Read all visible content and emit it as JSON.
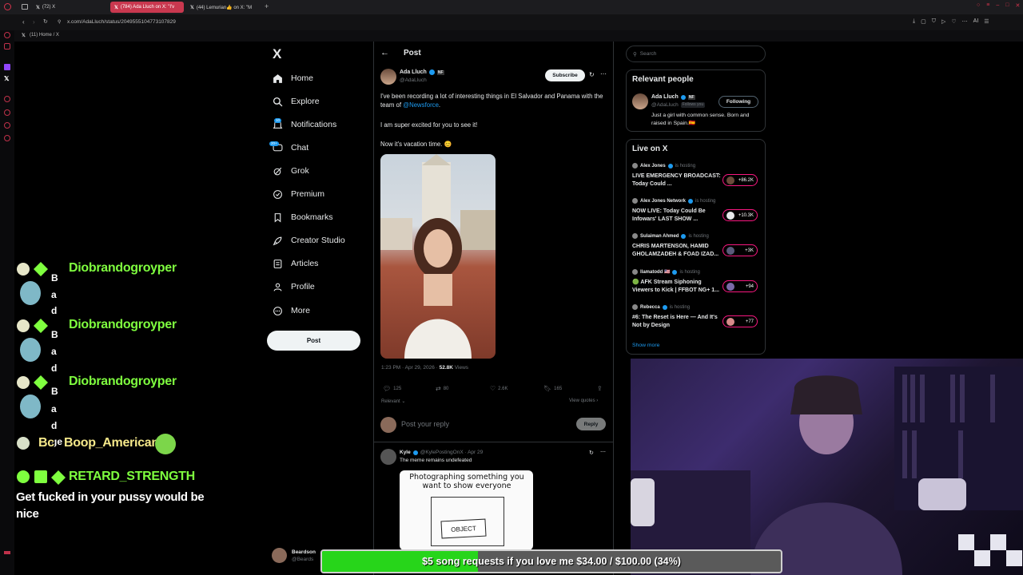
{
  "browser": {
    "tabs": [
      {
        "label": "(72) X"
      },
      {
        "label": "(784) Ada Lluch on X: \"I'v"
      },
      {
        "label": "(44) Lemurian👍 on X: \"M"
      }
    ],
    "url": "x.com/AdaLluch/status/2049555104773107829",
    "bookmark": "(11) Home / X",
    "ai_label": "AI"
  },
  "nav": {
    "logo": "X",
    "items": [
      {
        "label": "Home",
        "icon": "home-icon"
      },
      {
        "label": "Explore",
        "icon": "search-icon"
      },
      {
        "label": "Notifications",
        "icon": "bell-icon",
        "badge": "10"
      },
      {
        "label": "Chat",
        "icon": "chat-icon",
        "badge": "20+"
      },
      {
        "label": "Grok",
        "icon": "grok-icon"
      },
      {
        "label": "Premium",
        "icon": "premium-icon"
      },
      {
        "label": "Bookmarks",
        "icon": "bookmark-icon"
      },
      {
        "label": "Creator Studio",
        "icon": "rocket-icon"
      },
      {
        "label": "Articles",
        "icon": "articles-icon"
      },
      {
        "label": "Profile",
        "icon": "person-icon"
      },
      {
        "label": "More",
        "icon": "more-icon"
      }
    ],
    "post_button": "Post",
    "account": {
      "name": "Beardson",
      "handle": "@Beards"
    }
  },
  "post": {
    "header": "Post",
    "author": {
      "name": "Ada Lluch",
      "handle": "@AdaLluch"
    },
    "subscribe": "Subscribe",
    "text1a": "I've been recording a lot of interesting things in El Salvador and Panama with the team of ",
    "text1_link": "@Newsforce",
    "text1b": ".",
    "text2": "I am super excited for you to see it!",
    "text3": "Now it's vacation time. 😊",
    "time": "1:23 PM · Apr 29, 2026 · ",
    "views_count": "52.8K",
    "views_label": " Views",
    "stats": {
      "replies": "125",
      "reposts": "80",
      "likes": "2.6K",
      "bookmarks": "165"
    },
    "sort": "Relevant",
    "view_quotes": "View quotes",
    "reply_placeholder": "Post your reply",
    "reply_button": "Reply"
  },
  "reply": {
    "name": "Kyle",
    "handle": "@KylePostingOnX · Apr 29",
    "text": "The meme remains undefeated",
    "meme_caption": "Photographing something you want to show everyone",
    "meme_object": "OBJECT"
  },
  "right": {
    "search_placeholder": "Search",
    "relevant_title": "Relevant people",
    "person": {
      "name": "Ada Lluch",
      "handle": "@AdaLluch",
      "follows_you": "Follows you",
      "button": "Following",
      "bio": "Just a girl with common sense. Born and raised in Spain.🇪🇸"
    },
    "live_title": "Live on X",
    "live": [
      {
        "host": "Alex Jones",
        "suffix": "is hosting",
        "title": "LIVE EMERGENCY BROADCAST: Today Could ...",
        "count": "+86.2K"
      },
      {
        "host": "Alex Jones Network",
        "suffix": "is hosting",
        "title": "NOW LIVE: Today Could Be Infowars' LAST SHOW ...",
        "count": "+10.3K"
      },
      {
        "host": "Sulaiman Ahmed",
        "suffix": "is hosting",
        "title": "CHRIS MARTENSON, HAMID GHOLAMZADEH & FOAD IZAD...",
        "count": "+3K"
      },
      {
        "host": "llamatodd 🇺🇸",
        "suffix": "is hosting",
        "title": "🟢 AFK Stream Siphoning Viewers to Kick | FFBOT NG+ 1...",
        "count": "+94"
      },
      {
        "host": "Rebecca",
        "suffix": "is hosting",
        "title": "#6: The Reset is Here — And It's Not by Design",
        "count": "+77"
      }
    ],
    "show_more": "Show more"
  },
  "chat": {
    "users": [
      "Diobrandogroyper",
      "Diobrandogroyper",
      "Diobrandogroyper"
    ],
    "user4": "Boop_American",
    "user4_prefix": "Bc",
    "user5": "RETARD_STRENGTH",
    "message": "Get fucked in your pussy would be nice",
    "bad_letters": [
      "B",
      "a",
      "d",
      "ge"
    ]
  },
  "donation": {
    "text": "$5 song requests if you love me $34.00 / $100.00 (34%)",
    "progress": 0.34
  },
  "colors": {
    "accent": "#1d9bf0",
    "live": "#f91880",
    "chat_name": "#7fff3f",
    "donation_fill": "#27d51a"
  }
}
